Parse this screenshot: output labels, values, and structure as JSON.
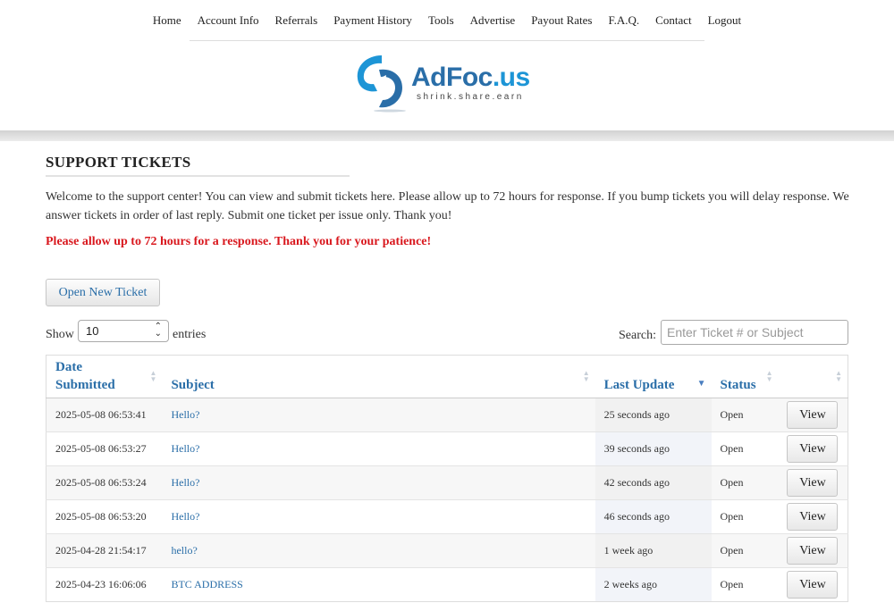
{
  "nav": {
    "items": [
      "Home",
      "Account Info",
      "Referrals",
      "Payment History",
      "Tools",
      "Advertise",
      "Payout Rates",
      "F.A.Q.",
      "Contact",
      "Logout"
    ]
  },
  "logo": {
    "name_main": "AdFoc",
    "name_suffix": ".us",
    "tagline": "shrink.share.earn",
    "colors": {
      "dark": "#2a6ea8",
      "light": "#1d95d6"
    }
  },
  "page": {
    "title": "SUPPORT TICKETS",
    "intro": "Welcome to the support center! You can view and submit tickets here. Please allow up to 72 hours for response. If you bump tickets you will delay response. We answer tickets in order of last reply. Submit one ticket per issue only. Thank you!",
    "warning": "Please allow up to 72 hours for a response. Thank you for your patience!",
    "warning_color": "#d9181e",
    "open_ticket_label": "Open New Ticket"
  },
  "controls": {
    "show_label": "Show",
    "entries_value": "10",
    "entries_label": "entries",
    "search_label": "Search:",
    "search_placeholder": "Enter Ticket # or Subject"
  },
  "table": {
    "headers": {
      "date": "Date Submitted",
      "subject": "Subject",
      "last_update": "Last Update",
      "status": "Status"
    },
    "sorted_column": "last_update",
    "rows": [
      {
        "date": "2025-05-08 06:53:41",
        "subject": "Hello?",
        "last_update": "25 seconds ago",
        "status": "Open",
        "action": "View"
      },
      {
        "date": "2025-05-08 06:53:27",
        "subject": "Hello?",
        "last_update": "39 seconds ago",
        "status": "Open",
        "action": "View"
      },
      {
        "date": "2025-05-08 06:53:24",
        "subject": "Hello?",
        "last_update": "42 seconds ago",
        "status": "Open",
        "action": "View"
      },
      {
        "date": "2025-05-08 06:53:20",
        "subject": "Hello?",
        "last_update": "46 seconds ago",
        "status": "Open",
        "action": "View"
      },
      {
        "date": "2025-04-28 21:54:17",
        "subject": "hello?",
        "last_update": "1 week ago",
        "status": "Open",
        "action": "View"
      },
      {
        "date": "2025-04-23 16:06:06",
        "subject": "BTC ADDRESS",
        "last_update": "2 weeks ago",
        "status": "Open",
        "action": "View"
      }
    ]
  }
}
